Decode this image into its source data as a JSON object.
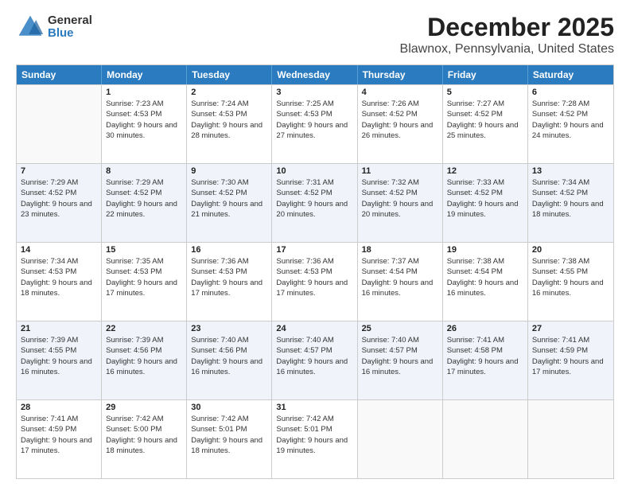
{
  "logo": {
    "general": "General",
    "blue": "Blue"
  },
  "title": "December 2025",
  "subtitle": "Blawnox, Pennsylvania, United States",
  "header_days": [
    "Sunday",
    "Monday",
    "Tuesday",
    "Wednesday",
    "Thursday",
    "Friday",
    "Saturday"
  ],
  "weeks": [
    [
      {
        "day": "",
        "sunrise": "",
        "sunset": "",
        "daylight": "",
        "empty": true
      },
      {
        "day": "1",
        "sunrise": "Sunrise: 7:23 AM",
        "sunset": "Sunset: 4:53 PM",
        "daylight": "Daylight: 9 hours and 30 minutes."
      },
      {
        "day": "2",
        "sunrise": "Sunrise: 7:24 AM",
        "sunset": "Sunset: 4:53 PM",
        "daylight": "Daylight: 9 hours and 28 minutes."
      },
      {
        "day": "3",
        "sunrise": "Sunrise: 7:25 AM",
        "sunset": "Sunset: 4:53 PM",
        "daylight": "Daylight: 9 hours and 27 minutes."
      },
      {
        "day": "4",
        "sunrise": "Sunrise: 7:26 AM",
        "sunset": "Sunset: 4:52 PM",
        "daylight": "Daylight: 9 hours and 26 minutes."
      },
      {
        "day": "5",
        "sunrise": "Sunrise: 7:27 AM",
        "sunset": "Sunset: 4:52 PM",
        "daylight": "Daylight: 9 hours and 25 minutes."
      },
      {
        "day": "6",
        "sunrise": "Sunrise: 7:28 AM",
        "sunset": "Sunset: 4:52 PM",
        "daylight": "Daylight: 9 hours and 24 minutes."
      }
    ],
    [
      {
        "day": "7",
        "sunrise": "Sunrise: 7:29 AM",
        "sunset": "Sunset: 4:52 PM",
        "daylight": "Daylight: 9 hours and 23 minutes."
      },
      {
        "day": "8",
        "sunrise": "Sunrise: 7:29 AM",
        "sunset": "Sunset: 4:52 PM",
        "daylight": "Daylight: 9 hours and 22 minutes."
      },
      {
        "day": "9",
        "sunrise": "Sunrise: 7:30 AM",
        "sunset": "Sunset: 4:52 PM",
        "daylight": "Daylight: 9 hours and 21 minutes."
      },
      {
        "day": "10",
        "sunrise": "Sunrise: 7:31 AM",
        "sunset": "Sunset: 4:52 PM",
        "daylight": "Daylight: 9 hours and 20 minutes."
      },
      {
        "day": "11",
        "sunrise": "Sunrise: 7:32 AM",
        "sunset": "Sunset: 4:52 PM",
        "daylight": "Daylight: 9 hours and 20 minutes."
      },
      {
        "day": "12",
        "sunrise": "Sunrise: 7:33 AM",
        "sunset": "Sunset: 4:52 PM",
        "daylight": "Daylight: 9 hours and 19 minutes."
      },
      {
        "day": "13",
        "sunrise": "Sunrise: 7:34 AM",
        "sunset": "Sunset: 4:52 PM",
        "daylight": "Daylight: 9 hours and 18 minutes."
      }
    ],
    [
      {
        "day": "14",
        "sunrise": "Sunrise: 7:34 AM",
        "sunset": "Sunset: 4:53 PM",
        "daylight": "Daylight: 9 hours and 18 minutes."
      },
      {
        "day": "15",
        "sunrise": "Sunrise: 7:35 AM",
        "sunset": "Sunset: 4:53 PM",
        "daylight": "Daylight: 9 hours and 17 minutes."
      },
      {
        "day": "16",
        "sunrise": "Sunrise: 7:36 AM",
        "sunset": "Sunset: 4:53 PM",
        "daylight": "Daylight: 9 hours and 17 minutes."
      },
      {
        "day": "17",
        "sunrise": "Sunrise: 7:36 AM",
        "sunset": "Sunset: 4:53 PM",
        "daylight": "Daylight: 9 hours and 17 minutes."
      },
      {
        "day": "18",
        "sunrise": "Sunrise: 7:37 AM",
        "sunset": "Sunset: 4:54 PM",
        "daylight": "Daylight: 9 hours and 16 minutes."
      },
      {
        "day": "19",
        "sunrise": "Sunrise: 7:38 AM",
        "sunset": "Sunset: 4:54 PM",
        "daylight": "Daylight: 9 hours and 16 minutes."
      },
      {
        "day": "20",
        "sunrise": "Sunrise: 7:38 AM",
        "sunset": "Sunset: 4:55 PM",
        "daylight": "Daylight: 9 hours and 16 minutes."
      }
    ],
    [
      {
        "day": "21",
        "sunrise": "Sunrise: 7:39 AM",
        "sunset": "Sunset: 4:55 PM",
        "daylight": "Daylight: 9 hours and 16 minutes."
      },
      {
        "day": "22",
        "sunrise": "Sunrise: 7:39 AM",
        "sunset": "Sunset: 4:56 PM",
        "daylight": "Daylight: 9 hours and 16 minutes."
      },
      {
        "day": "23",
        "sunrise": "Sunrise: 7:40 AM",
        "sunset": "Sunset: 4:56 PM",
        "daylight": "Daylight: 9 hours and 16 minutes."
      },
      {
        "day": "24",
        "sunrise": "Sunrise: 7:40 AM",
        "sunset": "Sunset: 4:57 PM",
        "daylight": "Daylight: 9 hours and 16 minutes."
      },
      {
        "day": "25",
        "sunrise": "Sunrise: 7:40 AM",
        "sunset": "Sunset: 4:57 PM",
        "daylight": "Daylight: 9 hours and 16 minutes."
      },
      {
        "day": "26",
        "sunrise": "Sunrise: 7:41 AM",
        "sunset": "Sunset: 4:58 PM",
        "daylight": "Daylight: 9 hours and 17 minutes."
      },
      {
        "day": "27",
        "sunrise": "Sunrise: 7:41 AM",
        "sunset": "Sunset: 4:59 PM",
        "daylight": "Daylight: 9 hours and 17 minutes."
      }
    ],
    [
      {
        "day": "28",
        "sunrise": "Sunrise: 7:41 AM",
        "sunset": "Sunset: 4:59 PM",
        "daylight": "Daylight: 9 hours and 17 minutes."
      },
      {
        "day": "29",
        "sunrise": "Sunrise: 7:42 AM",
        "sunset": "Sunset: 5:00 PM",
        "daylight": "Daylight: 9 hours and 18 minutes."
      },
      {
        "day": "30",
        "sunrise": "Sunrise: 7:42 AM",
        "sunset": "Sunset: 5:01 PM",
        "daylight": "Daylight: 9 hours and 18 minutes."
      },
      {
        "day": "31",
        "sunrise": "Sunrise: 7:42 AM",
        "sunset": "Sunset: 5:01 PM",
        "daylight": "Daylight: 9 hours and 19 minutes."
      },
      {
        "day": "",
        "sunrise": "",
        "sunset": "",
        "daylight": "",
        "empty": true
      },
      {
        "day": "",
        "sunrise": "",
        "sunset": "",
        "daylight": "",
        "empty": true
      },
      {
        "day": "",
        "sunrise": "",
        "sunset": "",
        "daylight": "",
        "empty": true
      }
    ]
  ]
}
